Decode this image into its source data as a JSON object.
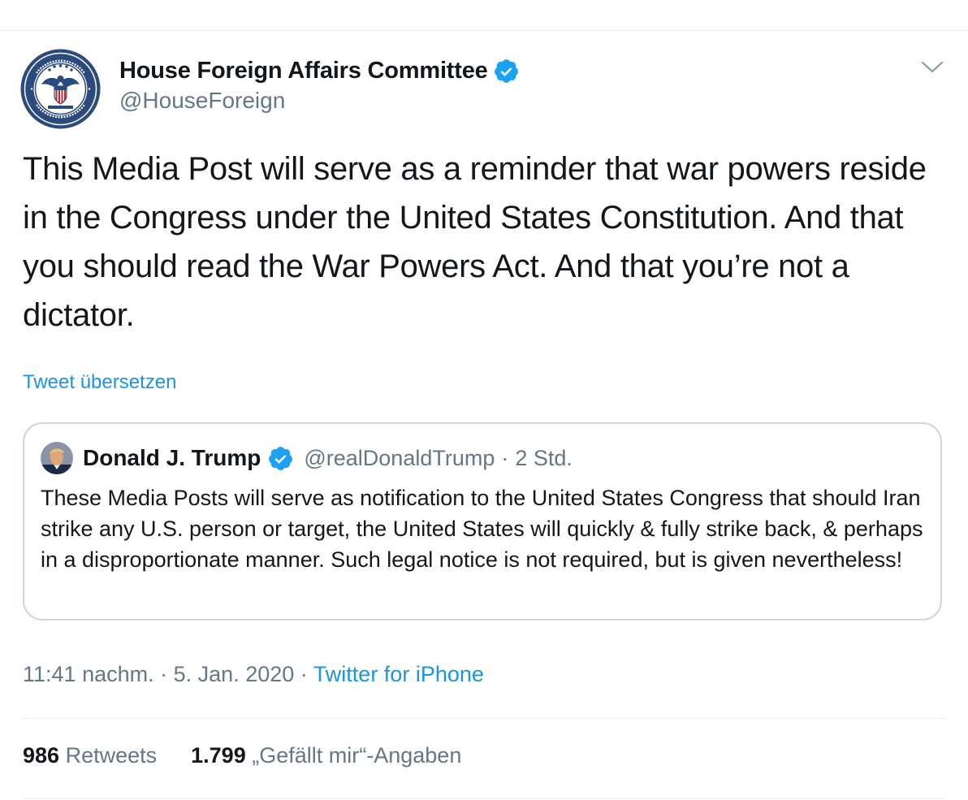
{
  "author": {
    "name": "House Foreign Affairs Committee",
    "handle": "@HouseForeign",
    "verified": true,
    "avatar_icon": "committee-seal-icon"
  },
  "tweet": {
    "text": "This Media Post will serve as a reminder that war powers reside in the Congress under the United States Constitution. And that you should read the War Powers Act. And that you’re not a dictator.",
    "translate_label": "Tweet übersetzen"
  },
  "quoted_tweet": {
    "name": "Donald J. Trump",
    "verified": true,
    "handle": "@realDonaldTrump",
    "separator": "·",
    "time": "2 Std.",
    "text": "These Media Posts will serve as notification to the United States Congress that should Iran strike any U.S. person or target, the United States will quickly & fully strike back, & perhaps in a disproportionate manner. Such legal notice is not required, but is given nevertheless!"
  },
  "meta": {
    "time": "11:41 nachm.",
    "date": "5. Jan. 2020",
    "separator": "·",
    "source": "Twitter for iPhone"
  },
  "stats": {
    "retweets_count": "986",
    "retweets_label": "Retweets",
    "likes_count": "1.799",
    "likes_label": "„Gefällt mir“-Angaben"
  },
  "colors": {
    "link": "#1b95e0",
    "verified": "#1da1f2",
    "muted": "#657786",
    "text": "#14171a",
    "border": "#ccd6dd"
  }
}
